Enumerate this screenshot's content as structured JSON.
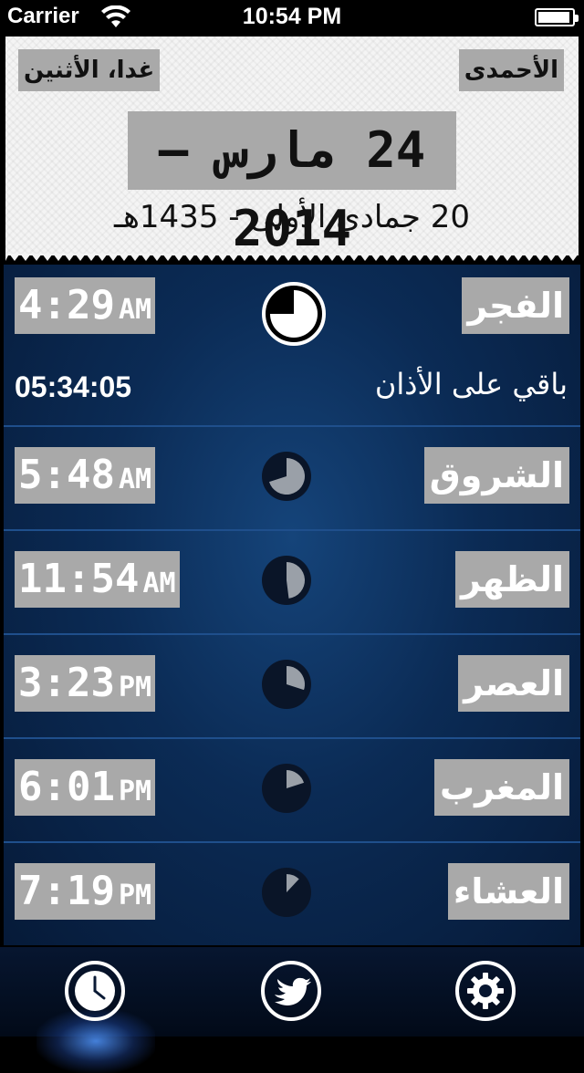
{
  "status_bar": {
    "carrier": "Carrier",
    "time": "10:54 PM"
  },
  "header": {
    "day_name": "الأحمدى",
    "next_label": "غدا، الأثنين",
    "gregorian_date": "24 مارس – 2014",
    "hijri_date": "20 جمادى الأولى - 1435هـ"
  },
  "prayers": [
    {
      "name": "الفجر",
      "time": "4:29",
      "ampm": "AM",
      "clock_fraction": 0.75,
      "active": true
    },
    {
      "name": "الشروق",
      "time": "5:48",
      "ampm": "AM",
      "clock_fraction": 0.7
    },
    {
      "name": "الظهر",
      "time": "11:54",
      "ampm": "AM",
      "clock_fraction": 0.48
    },
    {
      "name": "العصر",
      "time": "3:23",
      "ampm": "PM",
      "clock_fraction": 0.3
    },
    {
      "name": "المغرب",
      "time": "6:01",
      "ampm": "PM",
      "clock_fraction": 0.2
    },
    {
      "name": "العشاء",
      "time": "7:19",
      "ampm": "PM",
      "clock_fraction": 0.12
    }
  ],
  "countdown": {
    "value": "05:34:05",
    "label": "باقي على الأذان"
  },
  "tabbar": {
    "icons": [
      "clock-icon",
      "twitter-bird-icon",
      "gear-icon"
    ],
    "selected": "clock-icon"
  },
  "colors": {
    "label_bg": "#a9a9a9",
    "list_bg": "#0b2b55",
    "divider": "#1f4f8c"
  }
}
